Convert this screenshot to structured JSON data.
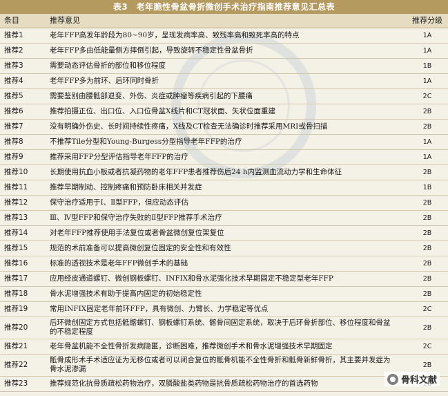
{
  "table": {
    "title": "表3　老年脆性骨盆骨折微创手术治疗指南推荐意见汇总表",
    "headers": {
      "id": "条目",
      "text": "推荐意见",
      "grade": "推荐分级"
    },
    "rows": [
      {
        "id": "推荐1",
        "text": "老年FFP高发年龄段为80~90岁，呈现发病率高、致残率高和致死率高的特点",
        "grade": "1A"
      },
      {
        "id": "推荐2",
        "text": "老年FFP多由低能量侧方摔倒引起，导致旋转不稳定性骨盆骨折",
        "grade": "1A"
      },
      {
        "id": "推荐3",
        "text": "需要动态评估骨折的部位和移位程度",
        "grade": "1B"
      },
      {
        "id": "推荐4",
        "text": "老年FFP多为前环、后环同时骨折",
        "grade": "1A"
      },
      {
        "id": "推荐5",
        "text": "需要鉴别由腰骶部退变、外伤、炎症或肿瘤等疾病引起的下腰痛",
        "grade": "2C"
      },
      {
        "id": "推荐6",
        "text": "推荐拍摄正位、出口位、入口位骨盆X线片和CT冠状面、矢状位面重建",
        "grade": "2B"
      },
      {
        "id": "推荐7",
        "text": "没有明确外伤史、长时间持续性疼痛，X线及CT检查无法确诊时推荐采用MRI或骨扫描",
        "grade": "2B"
      },
      {
        "id": "推荐8",
        "text": "不推荐Tile分型和Young-Burgess分型指导老年FFP的治疗",
        "grade": "1A"
      },
      {
        "id": "推荐9",
        "text": "推荐采用FFP分型评估指导老年FFP的治疗",
        "grade": "1A"
      },
      {
        "id": "推荐10",
        "text": "长期使用抗血小板或者抗凝药物的老年FFP患者推荐伤后24 h内监测血流动力学和生命体征",
        "grade": "2B"
      },
      {
        "id": "推荐11",
        "text": "推荐早期制动、控制疼痛和预防卧床相关并发症",
        "grade": "1B"
      },
      {
        "id": "推荐12",
        "text": "保守治疗适用于Ⅰ、Ⅱ型FFP，但应动态评估",
        "grade": "2B"
      },
      {
        "id": "推荐13",
        "text": "Ⅲ、Ⅳ型FFP和保守治疗失败的Ⅱ型FFP推荐手术治疗",
        "grade": "2B"
      },
      {
        "id": "推荐14",
        "text": "对老年FFP推荐使用手法复位或者骨盆微创复位架复位",
        "grade": "2B"
      },
      {
        "id": "推荐15",
        "text": "规范的术前准备可以提高微创复位固定的安全性和有效性",
        "grade": "2B"
      },
      {
        "id": "推荐16",
        "text": "标准的透视技术是老年FFP微创手术的基础",
        "grade": "2B"
      },
      {
        "id": "推荐17",
        "text": "应用经皮通道螺钉、微创钢板螺钉、INFIX和骨水泥强化技术早期固定不稳定型老年FFP",
        "grade": "2B"
      },
      {
        "id": "推荐18",
        "text": "骨水泥增强技术有助于提高内固定的初始稳定性",
        "grade": "2B"
      },
      {
        "id": "推荐19",
        "text": "常用INFIX固定老年前环FFP，具有微创、力臂长、力学稳定等优点",
        "grade": "2C"
      },
      {
        "id": "推荐20",
        "text": "后环微创固定方式包括骶髂螺钉、钢板螺钉系统、髂骨间固定系统，取决于后环骨折部位、移位程度和骨盆的不稳定程度",
        "grade": "2B"
      },
      {
        "id": "推荐21",
        "text": "老年骨盆机能不全性骨折发病隐匿，诊断困难，推荐微创手术和骨水泥增强技术早期固定",
        "grade": "2C"
      },
      {
        "id": "推荐22",
        "text": "骶骨成形术手术适应证为无移位或者可以闭合复位的骶骨机能不全性骨折和骶骨新鲜骨折，其主要并发症为骨水泥渗漏",
        "grade": "2B"
      },
      {
        "id": "推荐23",
        "text": "推荐规范化抗骨质疏松药物治疗，双膦酸盐类药物是抗骨质疏松药物治疗的首选药物",
        "grade": "2B"
      }
    ]
  },
  "watermark": {
    "label": "骨科文献",
    "icon": "wechat-logo-icon"
  },
  "colors": {
    "title_bg": "#b59a60",
    "header_bg": "#e6dcc2",
    "page_bg": "#f4f1e6"
  }
}
